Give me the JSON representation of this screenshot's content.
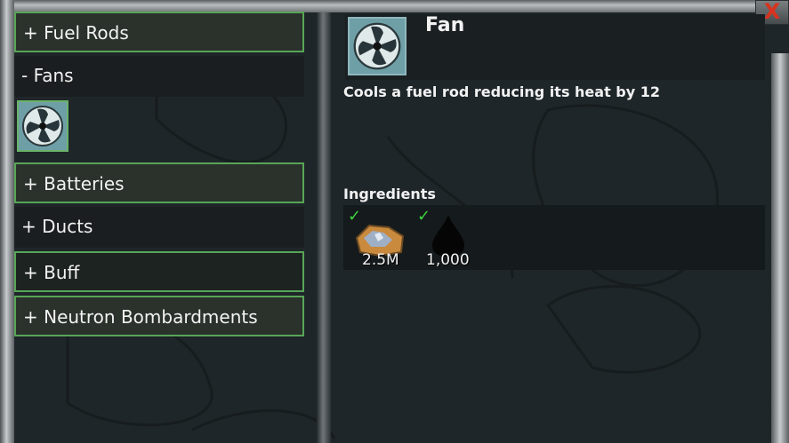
{
  "categories": [
    {
      "label": "+ Fuel Rods"
    },
    {
      "label": "- Fans"
    },
    {
      "label": "+ Batteries"
    },
    {
      "label": "+ Ducts"
    },
    {
      "label": "+ Buff"
    },
    {
      "label": "+ Neutron Bombardments"
    }
  ],
  "close_label": "X",
  "item": {
    "title": "Fan",
    "icon": "fan-icon",
    "description": "Cools a fuel rod reducing its heat by 12"
  },
  "ingredients": {
    "label": "Ingredients",
    "items": [
      {
        "icon": "ore-icon",
        "quantity": "2.5M",
        "satisfied": true
      },
      {
        "icon": "oil-drop-icon",
        "quantity": "1,000",
        "satisfied": true
      }
    ]
  },
  "colors": {
    "accent_green": "#58a557",
    "check_green": "#3cd23c",
    "close_red": "#d8331f"
  }
}
